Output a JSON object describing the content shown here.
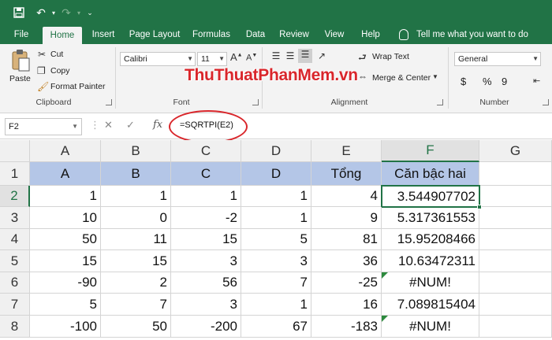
{
  "ribbon_tabs": [
    "File",
    "Home",
    "Insert",
    "Page Layout",
    "Formulas",
    "Data",
    "Review",
    "View",
    "Help"
  ],
  "tell_me": "Tell me what you want to do",
  "clipboard": {
    "paste": "Paste",
    "cut": "Cut",
    "copy": "Copy",
    "format_painter": "Format Painter",
    "label": "Clipboard"
  },
  "font": {
    "name": "Calibri",
    "size": "11",
    "label": "Font"
  },
  "alignment": {
    "wrap_text": "Wrap Text",
    "merge_center": "Merge & Center",
    "label": "Alignment"
  },
  "number": {
    "format": "General",
    "label": "Number",
    "symbols": [
      "$",
      "%",
      "9"
    ]
  },
  "watermark": "ThuThuatPhanMem.vn",
  "formula_bar": {
    "name_box": "F2",
    "formula": "=SQRTPI(E2)"
  },
  "columns": [
    "A",
    "B",
    "C",
    "D",
    "E",
    "F",
    "G"
  ],
  "rows": [
    "1",
    "2",
    "3",
    "4",
    "5",
    "6",
    "7",
    "8"
  ],
  "table": {
    "header": [
      "A",
      "B",
      "C",
      "D",
      "Tổng",
      "Căn bậc hai"
    ],
    "data": [
      [
        "1",
        "1",
        "1",
        "1",
        "4",
        "3.544907702"
      ],
      [
        "10",
        "0",
        "-2",
        "1",
        "9",
        "5.317361553"
      ],
      [
        "50",
        "11",
        "15",
        "5",
        "81",
        "15.95208466"
      ],
      [
        "15",
        "15",
        "3",
        "3",
        "36",
        "10.63472311"
      ],
      [
        "-90",
        "2",
        "56",
        "7",
        "-25",
        "#NUM!"
      ],
      [
        "5",
        "7",
        "3",
        "1",
        "16",
        "7.089815404"
      ],
      [
        "-100",
        "50",
        "-200",
        "67",
        "-183",
        "#NUM!"
      ]
    ]
  },
  "colors": {
    "excel_green": "#217346",
    "header_fill": "#b4c6e7",
    "highlight": "#d9262b"
  }
}
